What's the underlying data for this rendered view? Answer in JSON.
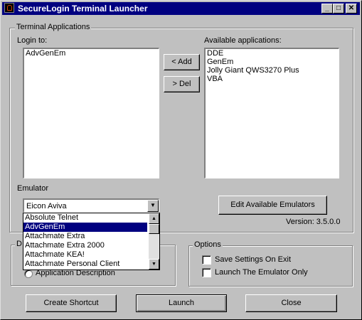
{
  "window": {
    "title": "SecureLogin Terminal Launcher",
    "controls": {
      "minimize": "_",
      "maximize": "□",
      "close": "✕"
    }
  },
  "terminal_applications": {
    "group_label": "Terminal Applications",
    "login_to_label": "Login to:",
    "login_to_items": [
      "AdvGenEm"
    ],
    "available_label": "Available applications:",
    "available_items": [
      "DDE",
      "GenEm",
      "Jolly Giant QWS3270 Plus",
      "VBA"
    ],
    "add_button": "< Add",
    "del_button": "> Del"
  },
  "emulator": {
    "label": "Emulator",
    "selected": "Eicon Aviva",
    "dropdown_arrow": "▼",
    "options": [
      "Absolute Telnet",
      "AdvGenEm",
      "Attachmate Extra",
      "Attachmate Extra 2000",
      "Attachmate KEA!",
      "Attachmate Personal Client"
    ],
    "highlighted": "AdvGenEm",
    "edit_button": "Edit Available Emulators",
    "version": "Version: 3.5.0.0"
  },
  "display": {
    "group_label_visible": "D",
    "option": "Application Description"
  },
  "options": {
    "group_label": "Options",
    "save_settings": "Save Settings On Exit",
    "launch_emulator_only": "Launch The Emulator Only"
  },
  "footer": {
    "create_shortcut": "Create Shortcut",
    "launch": "Launch",
    "close": "Close"
  },
  "icons": {
    "scroll_up": "▲",
    "scroll_down": "▼"
  }
}
